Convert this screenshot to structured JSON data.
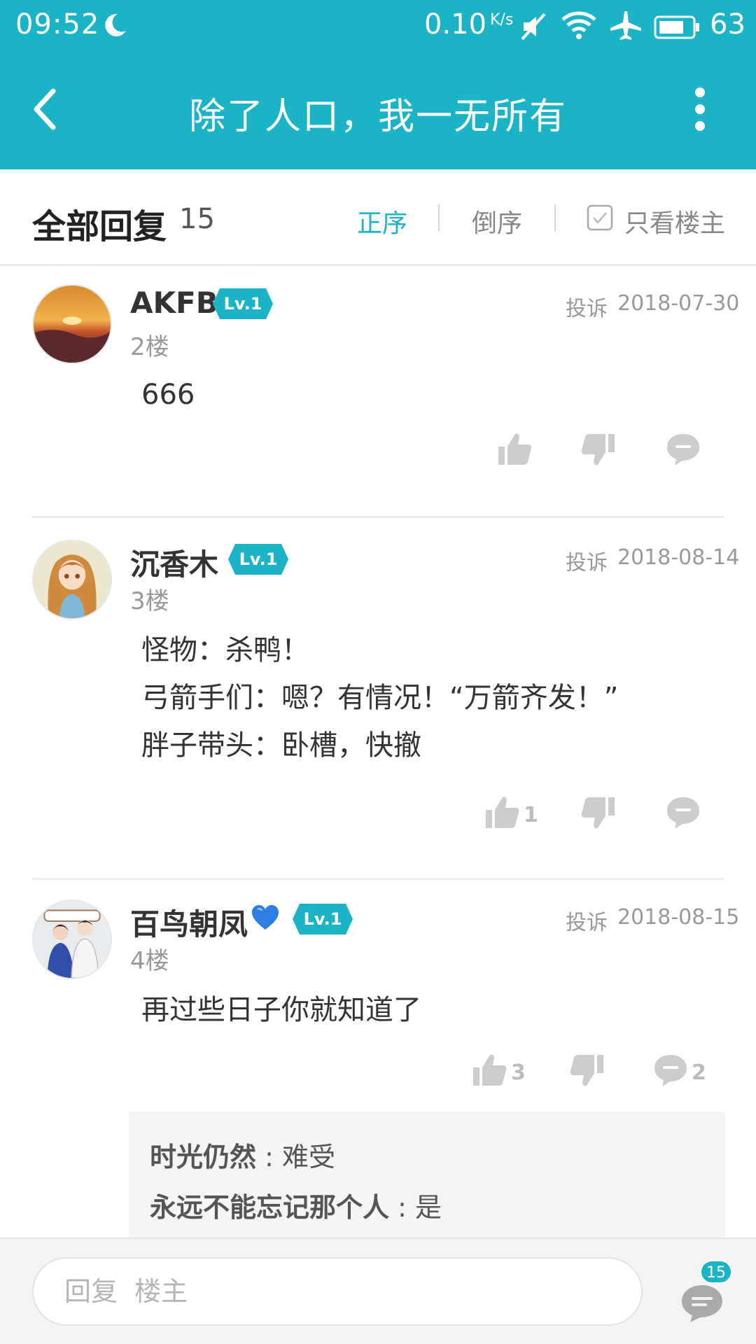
{
  "colors": {
    "accent": "#1ab4c6",
    "icon_gray": "#cccccc",
    "text_muted": "#999999"
  },
  "status_bar": {
    "time": "09:52",
    "net_speed": "0.10",
    "net_speed_unit": "K/s",
    "battery": "63",
    "icons": [
      "moon-icon",
      "mute-icon",
      "wifi-icon",
      "airplane-icon",
      "battery-icon"
    ]
  },
  "nav": {
    "title": "除了人口，我一无所有",
    "icons": [
      "back-icon",
      "more-icon"
    ]
  },
  "reply_header": {
    "title": "全部回复",
    "count": "15",
    "sort_asc": "正序",
    "sort_desc": "倒序",
    "only_op": "只看楼主",
    "only_op_checked": false
  },
  "posts": [
    {
      "username": "AKFB",
      "level": "Lv.1",
      "floor": "2楼",
      "report": "投诉",
      "date": "2018-07-30",
      "content": [
        "666"
      ],
      "likes": "",
      "replies": ""
    },
    {
      "username": "沉香木",
      "level": "Lv.1",
      "floor": "3楼",
      "report": "投诉",
      "date": "2018-08-14",
      "content": [
        "怪物：杀鸭！",
        "弓箭手们：嗯？有情况！“万箭齐发！”",
        "胖子带头：卧槽，快撤"
      ],
      "likes": "1",
      "replies": ""
    },
    {
      "username": "百鸟朝凤",
      "level": "Lv.1",
      "floor": "4楼",
      "report": "投诉",
      "date": "2018-08-15",
      "content": [
        "再过些日子你就知道了"
      ],
      "likes": "3",
      "replies": "2",
      "sub_replies": [
        {
          "author": "时光仍然",
          "sep": " : ",
          "text": "难受"
        },
        {
          "author": "永远不能忘记那个人",
          "sep": " : ",
          "text": "是"
        }
      ]
    }
  ],
  "bottom_bar": {
    "input_placeholder": "回复  楼主",
    "comment_count": "15"
  }
}
